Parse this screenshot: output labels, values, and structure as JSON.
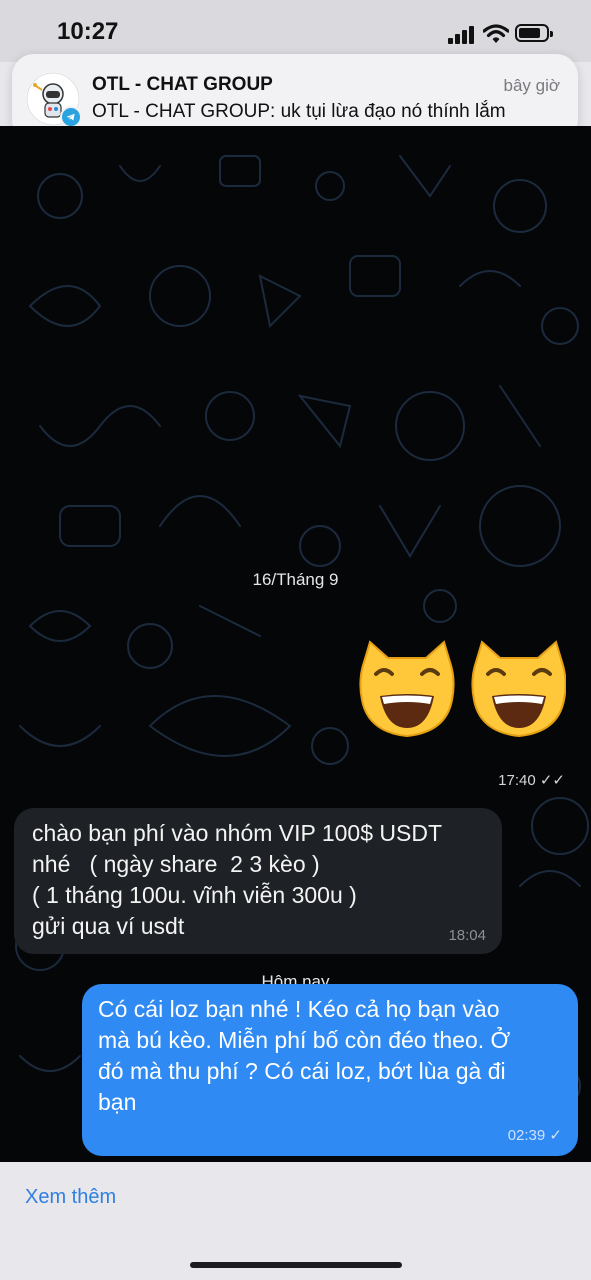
{
  "status_bar": {
    "time": "10:27",
    "signal_icon": "cellular-signal-icon",
    "wifi_icon": "wifi-icon",
    "battery_icon": "battery-icon",
    "battery_level": 0.8
  },
  "notification": {
    "app_icon": "telegram-icon",
    "title": "OTL - CHAT GROUP",
    "time": "bây giờ",
    "body": "OTL - CHAT GROUP: uk tụi lừa đạo nó thính lắm"
  },
  "chat": {
    "date_separator_1": "16/Tháng 9",
    "sticker_icons": [
      "grinning-cat-emoji",
      "grinning-cat-emoji"
    ],
    "sticker_time": "17:40",
    "incoming": {
      "lines": [
        "chào bạn phí vào nhóm VIP 100$ USDT",
        "nhé   ( ngày share  2 3 kèo )",
        "( 1 tháng 100u. vĩnh viễn 300u )",
        "gửi qua ví usdt"
      ],
      "time": "18:04"
    },
    "date_separator_2": "Hôm nay",
    "outgoing": {
      "lines": [
        "Có cái loz bạn nhé ! Kéo cả họ bạn vào",
        "mà bú kèo. Miễn phí bố còn đéo theo. Ở",
        "đó mà thu phí ? Có cái loz, bớt lùa gà đi",
        "bạn"
      ],
      "time": "02:39"
    }
  },
  "footer": {
    "more_label": "Xem thêm"
  },
  "colors": {
    "chat_bg": "#050608",
    "outgoing_bubble": "#2f8af3",
    "incoming_bubble": "#1e2226",
    "link": "#2f7fe0"
  }
}
